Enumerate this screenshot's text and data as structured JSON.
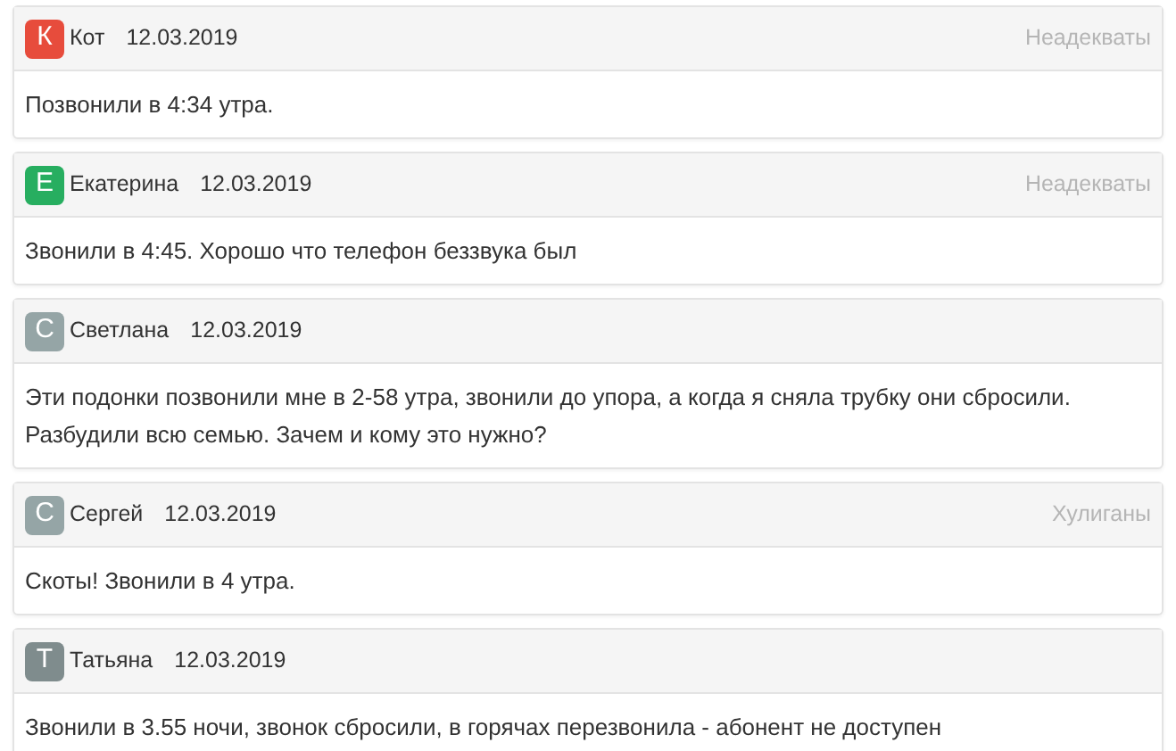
{
  "comments": [
    {
      "initial": "К",
      "color": "#e74c3c",
      "author": "Кот",
      "date": "12.03.2019",
      "category": "Неадекваты",
      "text": "Позвонили в 4:34 утра."
    },
    {
      "initial": "Е",
      "color": "#27ae60",
      "author": "Екатерина",
      "date": "12.03.2019",
      "category": "Неадекваты",
      "text": "Звонили в 4:45. Хорошо что телефон беззвука был"
    },
    {
      "initial": "С",
      "color": "#95a5a6",
      "author": "Светлана",
      "date": "12.03.2019",
      "text": "Эти подонки позвонили мне в 2-58 утра, звонили до упора, а когда я сняла трубку они сбросили. Разбудили всю семью. Зачем и кому это нужно?"
    },
    {
      "initial": "С",
      "color": "#95a5a6",
      "author": "Сергей",
      "date": "12.03.2019",
      "category": "Хулиганы",
      "text": "Скоты! Звонили в 4 утра."
    },
    {
      "initial": "Т",
      "color": "#7f8c8d",
      "author": "Татьяна",
      "date": "12.03.2019",
      "text": "Звонили в 3.55 ночи, звонок сбросили, в горячах перезвонила - абонент не доступен"
    }
  ]
}
